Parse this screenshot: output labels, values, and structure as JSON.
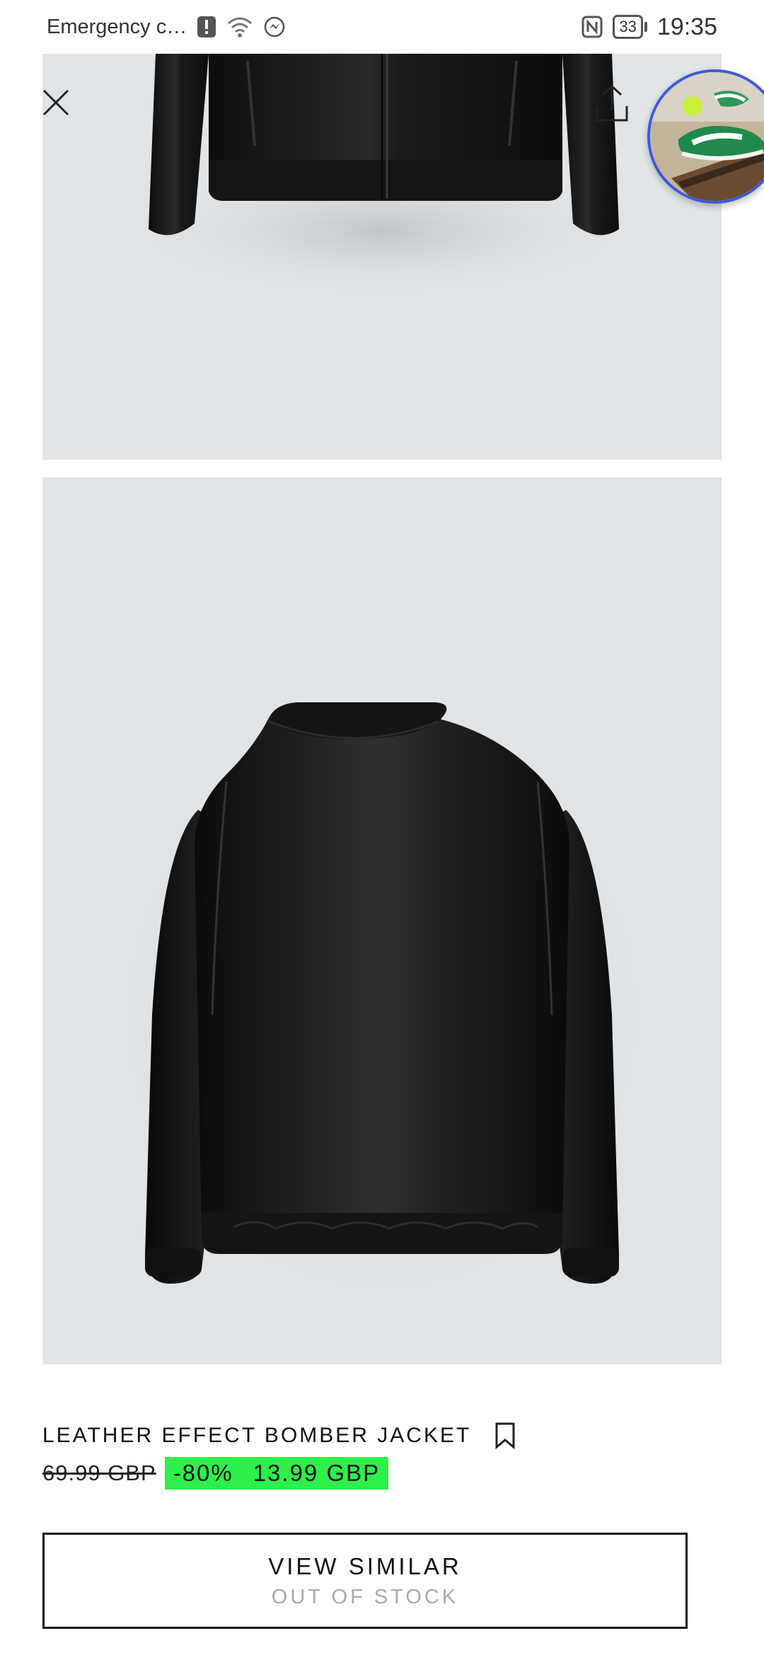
{
  "status_bar": {
    "left_text": "Emergency c…",
    "battery": "33",
    "time": "19:35"
  },
  "product": {
    "title": "LEATHER EFFECT BOMBER JACKET",
    "old_price": "69.99 GBP",
    "discount": "-80%",
    "new_price": "13.99 GBP",
    "sale_color": "#2ef04a"
  },
  "cta": {
    "label": "VIEW SIMILAR",
    "sublabel": "OUT OF STOCK"
  },
  "icons": {
    "close": "close-icon",
    "share": "share-icon",
    "bookmark": "bookmark-icon"
  }
}
